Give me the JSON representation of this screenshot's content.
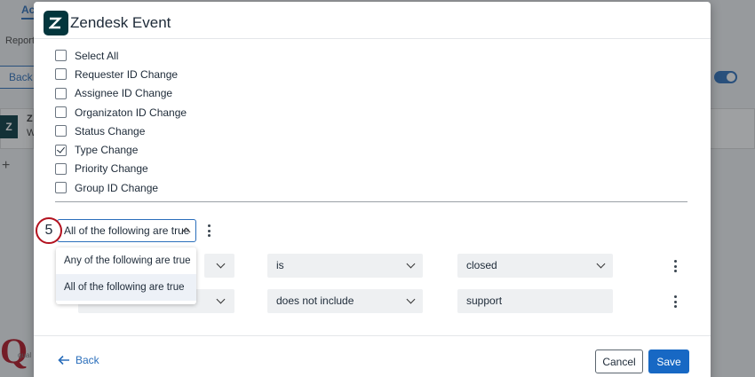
{
  "background": {
    "tab_label": "Ac",
    "reporting_label": "Reporti",
    "back_label": "Back",
    "card_letter_1": "Z",
    "card_letter_2": "W",
    "logo_letter": "Z"
  },
  "modal": {
    "title": "Zendesk Event",
    "logo_icon": "zendesk-logo-icon"
  },
  "events": [
    {
      "label": "Select All",
      "checked": false
    },
    {
      "label": "Requester ID Change",
      "checked": false
    },
    {
      "label": "Assignee ID Change",
      "checked": false
    },
    {
      "label": "Organizaton ID Change",
      "checked": false
    },
    {
      "label": "Status Change",
      "checked": false
    },
    {
      "label": "Type Change",
      "checked": true
    },
    {
      "label": "Priority Change",
      "checked": false
    },
    {
      "label": "Group ID Change",
      "checked": false
    }
  ],
  "conditions": {
    "step_number": "5",
    "logic_selected": "All of the following are true",
    "logic_options": [
      "Any of the following are true",
      "All of the following are true"
    ],
    "rows": [
      {
        "operator": "is",
        "value": "closed"
      },
      {
        "operator": "does not include",
        "value": "support"
      }
    ]
  },
  "footer": {
    "back_label": "Back",
    "cancel_label": "Cancel",
    "save_label": "Save"
  },
  "colors": {
    "accent": "#1768c4",
    "zendesk": "#03363d",
    "step_ring": "#b3121f"
  }
}
